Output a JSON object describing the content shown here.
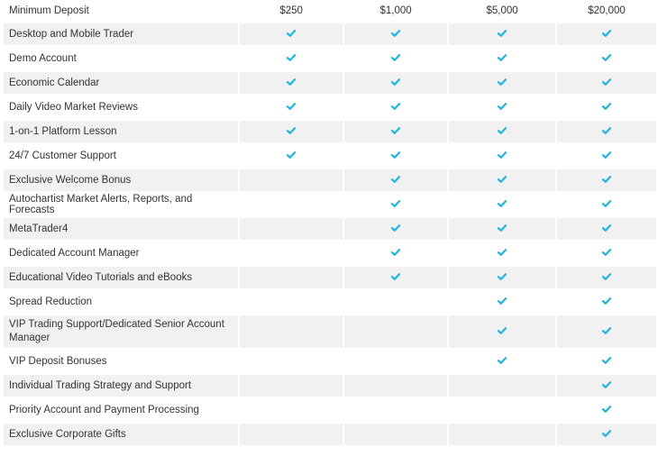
{
  "accent_color": "#1db5e2",
  "header": {
    "label": "Minimum Deposit",
    "tiers": [
      "$250",
      "$1,000",
      "$5,000",
      "$20,000"
    ]
  },
  "rows": [
    {
      "feature": "Desktop and Mobile Trader",
      "checks": [
        true,
        true,
        true,
        true
      ]
    },
    {
      "feature": "Demo Account",
      "checks": [
        true,
        true,
        true,
        true
      ]
    },
    {
      "feature": "Economic Calendar",
      "checks": [
        true,
        true,
        true,
        true
      ]
    },
    {
      "feature": "Daily Video Market Reviews",
      "checks": [
        true,
        true,
        true,
        true
      ]
    },
    {
      "feature": "1-on-1 Platform Lesson",
      "checks": [
        true,
        true,
        true,
        true
      ]
    },
    {
      "feature": "24/7 Customer Support",
      "checks": [
        true,
        true,
        true,
        true
      ]
    },
    {
      "feature": "Exclusive Welcome Bonus",
      "checks": [
        false,
        true,
        true,
        true
      ]
    },
    {
      "feature": "Autochartist Market Alerts, Reports, and Forecasts",
      "checks": [
        false,
        true,
        true,
        true
      ]
    },
    {
      "feature": "MetaTrader4",
      "checks": [
        false,
        true,
        true,
        true
      ]
    },
    {
      "feature": "Dedicated Account Manager",
      "checks": [
        false,
        true,
        true,
        true
      ]
    },
    {
      "feature": "Educational Video Tutorials and eBooks",
      "checks": [
        false,
        true,
        true,
        true
      ]
    },
    {
      "feature": "Spread Reduction",
      "checks": [
        false,
        false,
        true,
        true
      ]
    },
    {
      "feature": "VIP Trading Support/Dedicated Senior Account Manager",
      "checks": [
        false,
        false,
        true,
        true
      ]
    },
    {
      "feature": "VIP Deposit Bonuses",
      "checks": [
        false,
        false,
        true,
        true
      ]
    },
    {
      "feature": "Individual Trading Strategy and Support",
      "checks": [
        false,
        false,
        false,
        true
      ]
    },
    {
      "feature": "Priority Account and Payment Processing",
      "checks": [
        false,
        false,
        false,
        true
      ]
    },
    {
      "feature": "Exclusive Corporate Gifts",
      "checks": [
        false,
        false,
        false,
        true
      ]
    }
  ]
}
